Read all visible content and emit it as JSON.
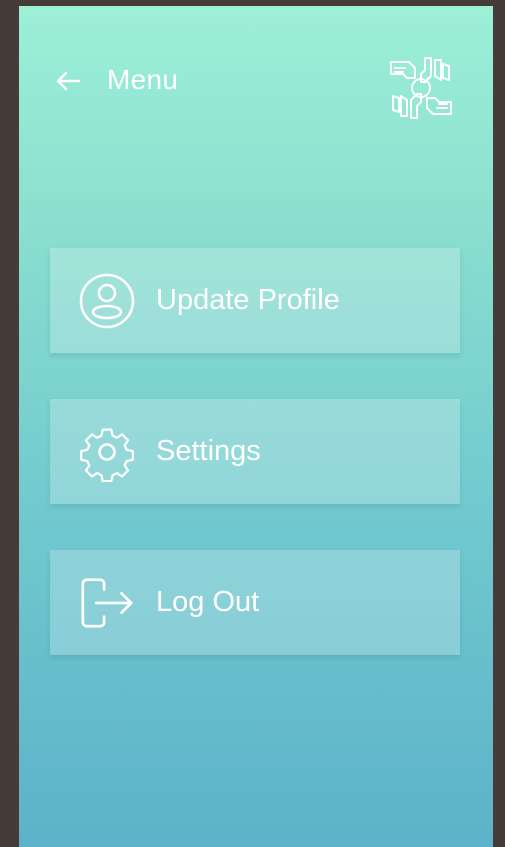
{
  "header": {
    "back_icon": "arrow-left-icon",
    "title": "Menu",
    "logo_icon": "hands-circle-logo"
  },
  "menu": {
    "items": [
      {
        "label": "Update Profile",
        "icon": "user-circle-icon"
      },
      {
        "label": "Settings",
        "icon": "gear-icon"
      },
      {
        "label": "Log Out",
        "icon": "logout-icon"
      }
    ]
  },
  "colors": {
    "frame": "#463b36",
    "gradient_top": "#9df0d6",
    "gradient_bottom": "#5cb2c8",
    "text": "#ffffff"
  }
}
